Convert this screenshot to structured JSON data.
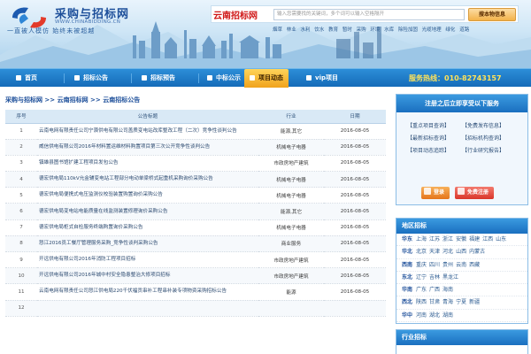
{
  "header": {
    "logo_title": "采购与招标网",
    "logo_url": "WWW.CHINABIDDING.CN",
    "slogan": "一直被人模仿  始终未被超越",
    "site_tag": "云南招标网",
    "search_placeholder": "输入您需要找的关键词，多个词可以输入空格隔开",
    "search_button": "搜本物信息",
    "hot_keywords": [
      "烟草",
      "林业",
      "水利",
      "饮水",
      "教育",
      "暂时",
      "采购",
      "环境",
      "水库",
      "除险加固",
      "光缆地理",
      "绿化",
      "道路"
    ]
  },
  "nav": {
    "items": [
      "首页",
      "招标公告",
      "招标预告",
      "中标公示",
      "项目动态",
      "vip项目"
    ],
    "active_index": 4,
    "hotline": "服务热线：010-82743157"
  },
  "breadcrumb": "采购与招标网 >> 云南招标网 >> 云南招标公告",
  "table": {
    "headers": [
      "序号",
      "公告标题",
      "行业",
      "日期"
    ],
    "rows": [
      [
        "1",
        "云南电网有限责任公司宁蒗供电有限公司盖质变电站改库整改工程（二次）竞争性谈判公告",
        "能源,其它",
        "2016-08-05"
      ],
      [
        "2",
        "威信供电有限公司2016年材料置运维材料购置项目第三次公开竞争性谈判公告",
        "机械电子电器",
        "2016-08-05"
      ],
      [
        "3",
        "镇雄县图书馆扩建工程项目发包公告",
        "市政房地产建筑",
        "2016-08-05"
      ],
      [
        "4",
        "德宏供电局110kV允金辅变电站工程部分电动单梁桥式起重机采购询价采购公告",
        "机械电子电器",
        "2016-08-05"
      ],
      [
        "5",
        "德宏供电局便携式电压监测仪校验装置购置询价采购公告",
        "机械电子电器",
        "2016-08-05"
      ],
      [
        "6",
        "德宏供电局变电站电能质量在线监测装置修理询价采购公告",
        "能源,其它",
        "2016-08-05"
      ],
      [
        "7",
        "德宏供电局柜式自检服务终端购置询价采购公告",
        "机械电子电器",
        "2016-08-05"
      ],
      [
        "8",
        "怒江2016员工餐厅管理服务采购_竞争性谈判采购公告",
        "商业服务",
        "2016-08-05"
      ],
      [
        "9",
        "开远供电有限公司2016年消防工程项目招标",
        "市政房地产建筑",
        "2016-08-05"
      ],
      [
        "10",
        "开远供电有限公司2016年城中村安全隐患整治大修项目招标",
        "市政房地产建筑",
        "2016-08-05"
      ],
      [
        "11",
        "云南电网有限责任公司怒江供电局220千伏福贡串补工程串补装专项物资采购招标公告",
        "能源",
        "2016-08-05"
      ],
      [
        "12",
        "",
        "",
        ""
      ]
    ]
  },
  "login_box": {
    "title": "注册之后立即享受以下服务",
    "services": [
      "【重点项目查询】",
      "【免费发布信息】",
      "【最新招标查询】",
      "【招标机构查询】",
      "【项目动态追踪】",
      "【行业研究报告】"
    ],
    "login_label": "登录",
    "register_label": "免费注册"
  },
  "region_box": {
    "title": "地区招标",
    "rows": [
      {
        "region": "华东",
        "provinces": [
          "上海",
          "江苏",
          "浙江",
          "安徽",
          "福建",
          "江西",
          "山东"
        ]
      },
      {
        "region": "华北",
        "provinces": [
          "北京",
          "天津",
          "河北",
          "山西",
          "内蒙古"
        ]
      },
      {
        "region": "西南",
        "provinces": [
          "重庆",
          "四川",
          "贵州",
          "云南",
          "西藏"
        ]
      },
      {
        "region": "东北",
        "provinces": [
          "辽宁",
          "吉林",
          "黑龙江"
        ]
      },
      {
        "region": "华南",
        "provinces": [
          "广东",
          "广西",
          "海南"
        ]
      },
      {
        "region": "西北",
        "provinces": [
          "陕西",
          "甘肃",
          "青海",
          "宁夏",
          "新疆"
        ]
      },
      {
        "region": "华中",
        "provinces": [
          "河南",
          "湖北",
          "湖南"
        ]
      }
    ]
  },
  "industry_box": {
    "title": "行业招标"
  },
  "colors": {
    "nav_blue": "#1a6fbf",
    "active_gold": "#f0a21c",
    "site_red": "#d01818",
    "link_blue": "#1d4f9a"
  }
}
